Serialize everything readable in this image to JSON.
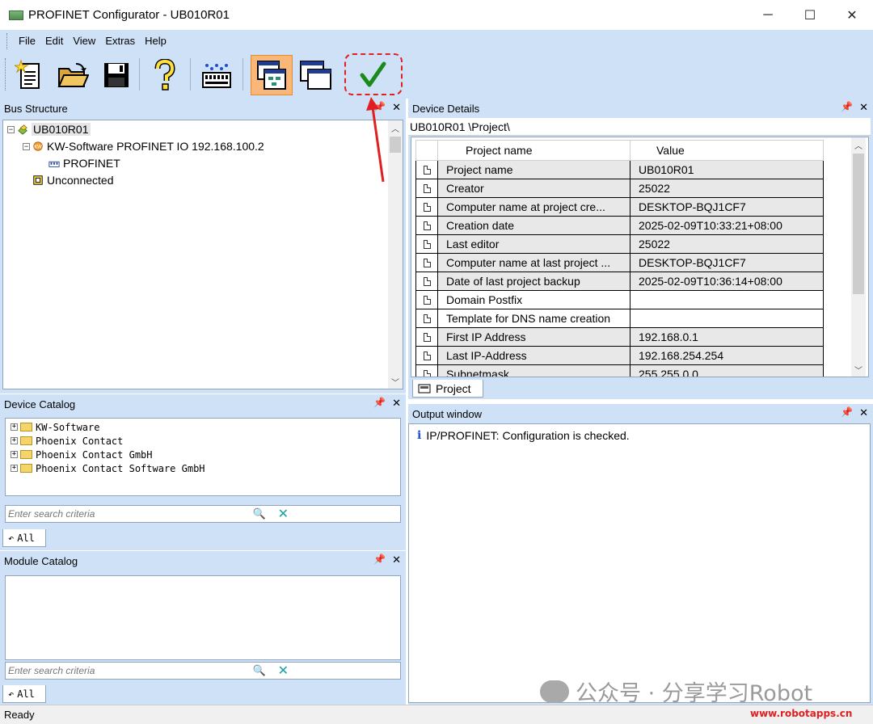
{
  "window": {
    "title": "PROFINET Configurator - UB010R01",
    "minimize": "─",
    "maximize": "☐",
    "close": "✕"
  },
  "menu": [
    "File",
    "Edit",
    "View",
    "Extras",
    "Help"
  ],
  "toolbar": {
    "buttons": [
      "new-project-icon",
      "open-folder-icon",
      "save-disk-icon",
      "help-icon",
      "network-scan-icon",
      "window-view-icon",
      "window-view-2-icon",
      "check-configuration-icon"
    ],
    "accent_active": "#f9b87a",
    "highlight_color": "#e02020"
  },
  "bus_structure": {
    "title": "Bus Structure",
    "tree": {
      "root": "UB010R01",
      "controller": "KW-Software PROFINET IO 192.168.100.2",
      "network": "PROFINET",
      "unconnected": "Unconnected"
    }
  },
  "device_details": {
    "title": "Device Details",
    "path": "UB010R01 \\Project\\",
    "columns": [
      "Project name",
      "Value"
    ],
    "rows": [
      {
        "name": "Project name",
        "value": "UB010R01"
      },
      {
        "name": "Creator",
        "value": "25022"
      },
      {
        "name": "Computer name at project cre...",
        "value": "DESKTOP-BQJ1CF7"
      },
      {
        "name": "Creation date",
        "value": "2025-02-09T10:33:21+08:00"
      },
      {
        "name": "Last editor",
        "value": "25022"
      },
      {
        "name": "Computer name at last project ...",
        "value": "DESKTOP-BQJ1CF7"
      },
      {
        "name": "Date of last project backup",
        "value": "2025-02-09T10:36:14+08:00"
      },
      {
        "name": "Domain Postfix",
        "value": ""
      },
      {
        "name": "Template for DNS name creation",
        "value": ""
      },
      {
        "name": "First IP Address",
        "value": "192.168.0.1"
      },
      {
        "name": "Last IP-Address",
        "value": "192.168.254.254"
      },
      {
        "name": "Subnetmask",
        "value": "255.255.0.0"
      }
    ],
    "tab": "Project"
  },
  "device_catalog": {
    "title": "Device Catalog",
    "items": [
      "KW-Software",
      "Phoenix Contact",
      "Phoenix Contact GmbH",
      "Phoenix Contact Software GmbH"
    ],
    "search_placeholder": "Enter search criteria",
    "tab": "All"
  },
  "module_catalog": {
    "title": "Module Catalog",
    "search_placeholder": "Enter search criteria",
    "tab": "All"
  },
  "output_window": {
    "title": "Output window",
    "message": "IP/PROFINET: Configuration is checked."
  },
  "status": "Ready",
  "watermark": {
    "text": "公众号 · 分享学习Robot",
    "url": "www.robotapps.cn"
  }
}
